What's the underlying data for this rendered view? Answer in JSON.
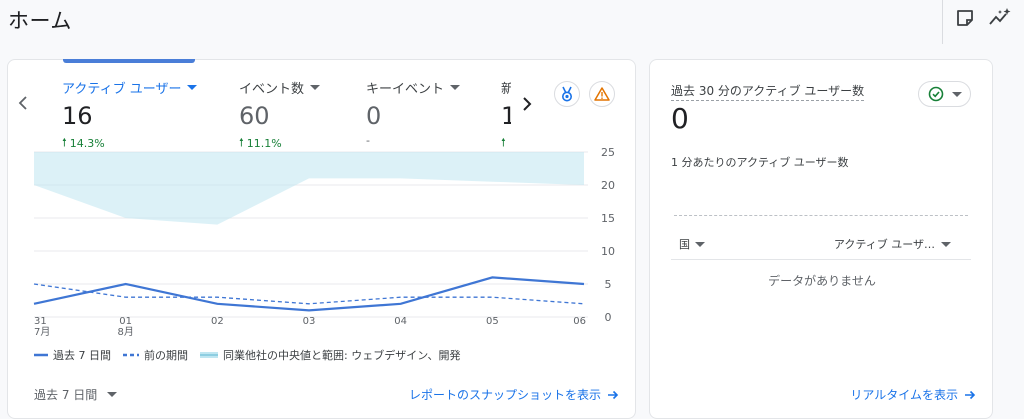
{
  "header": {
    "title": "ホーム"
  },
  "metrics": [
    {
      "label": "アクティブ ユーザー",
      "value": "16",
      "change": "14.3%",
      "active": true
    },
    {
      "label": "イベント数",
      "value": "60",
      "change": "11.1%"
    },
    {
      "label": "キーイベント",
      "value": "0",
      "change": "-"
    },
    {
      "label": "新",
      "value": "1",
      "change": ""
    }
  ],
  "chart_data": {
    "type": "line",
    "categories": [
      "31\n7月",
      "01\n8月",
      "02",
      "03",
      "04",
      "05",
      "06"
    ],
    "x_ticks": [
      {
        "day": "31",
        "month": "7月"
      },
      {
        "day": "01",
        "month": "8月"
      },
      {
        "day": "02",
        "month": ""
      },
      {
        "day": "03",
        "month": ""
      },
      {
        "day": "04",
        "month": ""
      },
      {
        "day": "05",
        "month": ""
      },
      {
        "day": "06",
        "month": ""
      }
    ],
    "y_ticks": [
      0,
      5,
      10,
      15,
      20,
      25
    ],
    "ylim": [
      0,
      25
    ],
    "series": [
      {
        "name": "過去 7 日間",
        "values": [
          2,
          5,
          2,
          1,
          2,
          6,
          5
        ],
        "color": "#3f76d4",
        "style": "solid"
      },
      {
        "name": "前の期間",
        "values": [
          5,
          3,
          3,
          2,
          3,
          3,
          2
        ],
        "color": "#3f76d4",
        "style": "dashed"
      }
    ],
    "band": {
      "name": "同業他社の中央値と範囲: ウェブデザイン、開発",
      "upper": [
        25,
        25,
        25,
        25,
        25,
        25,
        25
      ],
      "lower": [
        20,
        15,
        14,
        21,
        21,
        20.5,
        20
      ],
      "color": "#bfe6f1"
    },
    "grid": true,
    "legend": "bottom-left"
  },
  "footer": {
    "range_label": "過去 7 日間",
    "snapshot_link": "レポートのスナップショットを表示"
  },
  "realtime": {
    "title": "過去 30 分のアクティブ ユーザー数",
    "value": "0",
    "subtitle": "1 分あたりのアクティブ ユーザー数",
    "col_country": "国",
    "col_users": "アクティブ ユーザ…",
    "empty": "データがありません",
    "link": "リアルタイムを表示"
  },
  "colors": {
    "accent": "#1a73e8",
    "positive": "#188038",
    "band": "#bfe6f1"
  }
}
